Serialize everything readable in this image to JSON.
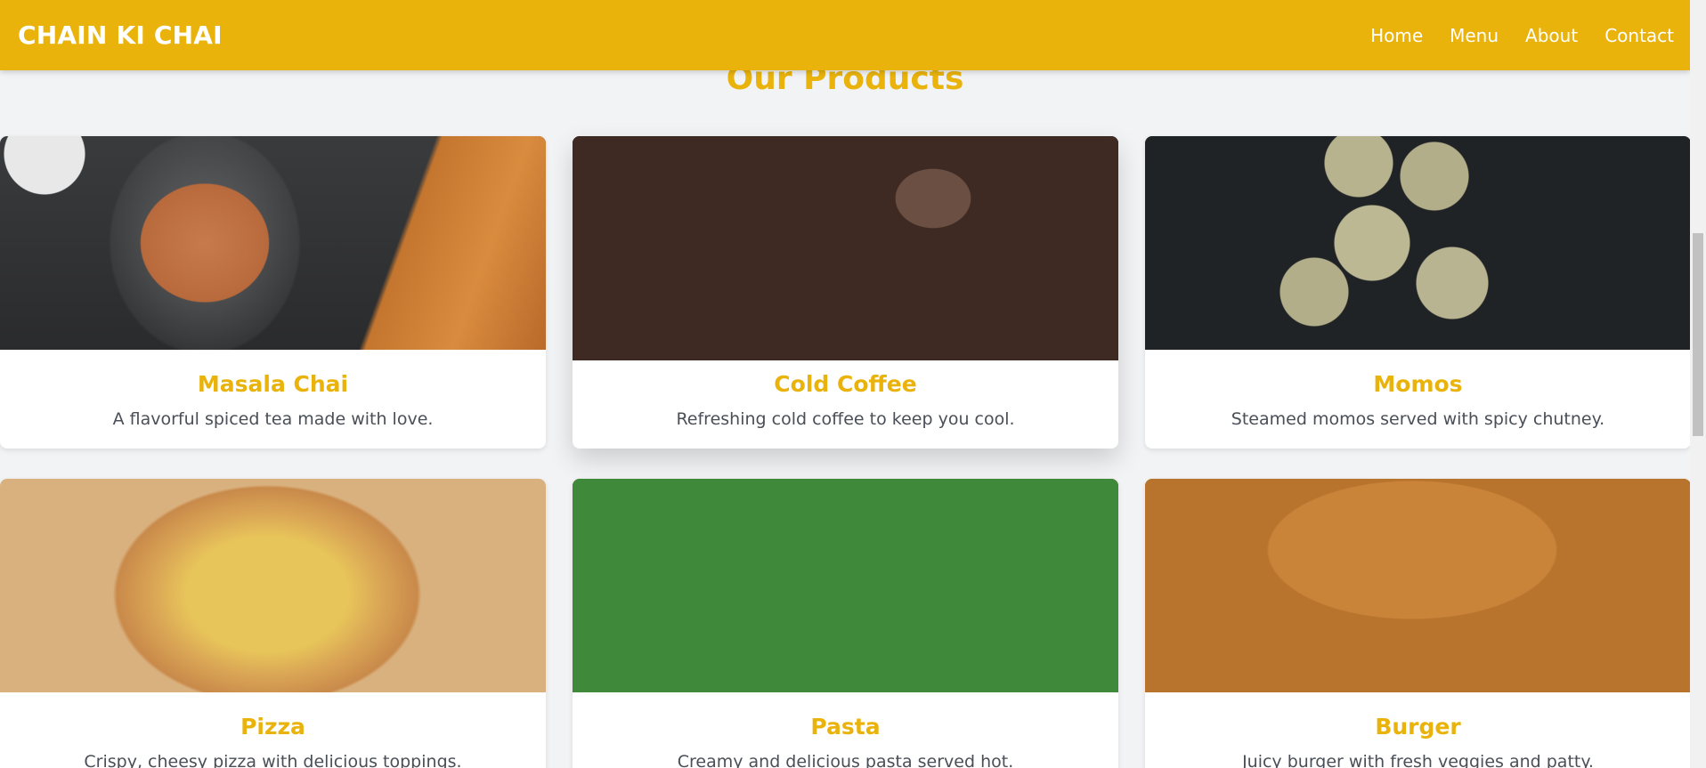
{
  "header": {
    "brand": "CHAIN KI CHAI",
    "nav": [
      "Home",
      "Menu",
      "About",
      "Contact"
    ]
  },
  "section": {
    "title": "Our Products"
  },
  "products": [
    {
      "name": "Masala Chai",
      "description": "A flavorful spiced tea made with love."
    },
    {
      "name": "Cold Coffee",
      "description": "Refreshing cold coffee to keep you cool."
    },
    {
      "name": "Momos",
      "description": "Steamed momos served with spicy chutney."
    },
    {
      "name": "Pizza",
      "description": "Crispy, cheesy pizza with delicious toppings."
    },
    {
      "name": "Pasta",
      "description": "Creamy and delicious pasta served hot."
    },
    {
      "name": "Burger",
      "description": "Juicy burger with fresh veggies and patty."
    }
  ],
  "colors": {
    "accent": "#e9b30b",
    "background": "#f2f3f5",
    "text": "#4a4f57"
  }
}
